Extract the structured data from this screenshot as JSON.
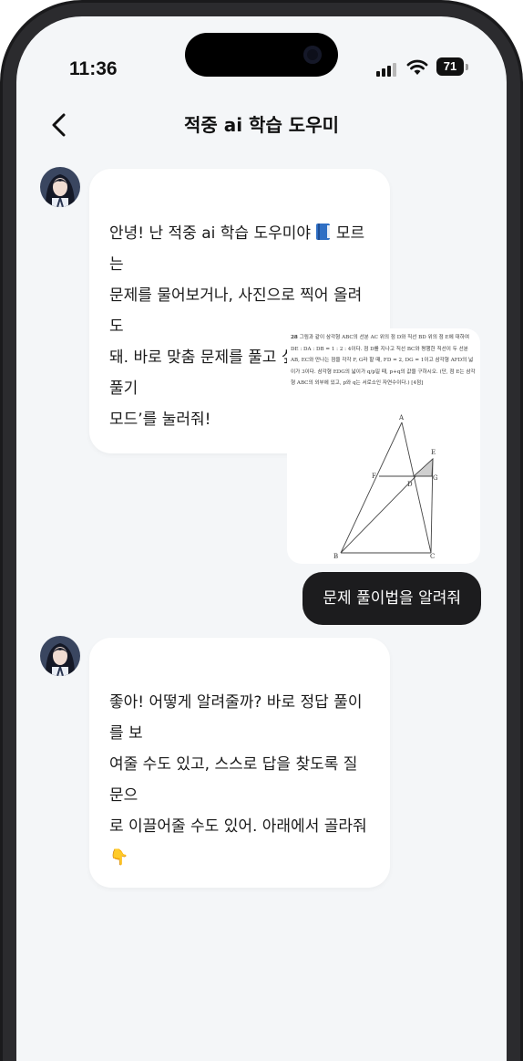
{
  "status_bar": {
    "time": "11:36",
    "battery": "71"
  },
  "header": {
    "title": "적중 ai 학습 도우미"
  },
  "messages": {
    "bot_1_before_emoji": "안녕! 난 적중 ai 학습 도우미야 ",
    "bot_1_after_emoji": " 모르는\n문제를 물어보거나, 사진으로 찍어 올려도\n돼. 바로 맞춤 문제를 풀고 싶으면 ‘문제 풀기\n모드’를 눌러줘!",
    "user_1": "문제 풀이법을 알려줘",
    "bot_2": "좋아! 어떻게 알려줄까? 바로 정답 풀이를 보\n여줄 수도 있고, 스스로 답을 찾도록 질문으\n로 이끌어줄 수도 있어. 아래에서 골라줘\n👇"
  },
  "problem_image": {
    "number": "28",
    "text": "그림과 같이 삼각형 ABC의 선분 AC 위의 점 D와 직선 BD 위의 점 E에 대하여 DE : DA : DB = 1 : 2 : 4이다. 점 D를 지나고 직선 BC와 평행한 직선이 두 선분 AB, EC와 만나는 점을 각각 F, G라 할 때, FD = 2, DG = 1이고 삼각형 AFD의 넓이가 3이다. 삼각형 EDG의 넓이가 q/p일 때, p+q의 값을 구하시오. (단, 점 E는 삼각형 ABC의 외부에 있고, p와 q는 서로소인 자연수이다.) [4점]",
    "labels": {
      "A": "A",
      "B": "B",
      "C": "C",
      "D": "D",
      "E": "E",
      "F": "F",
      "G": "G"
    }
  }
}
